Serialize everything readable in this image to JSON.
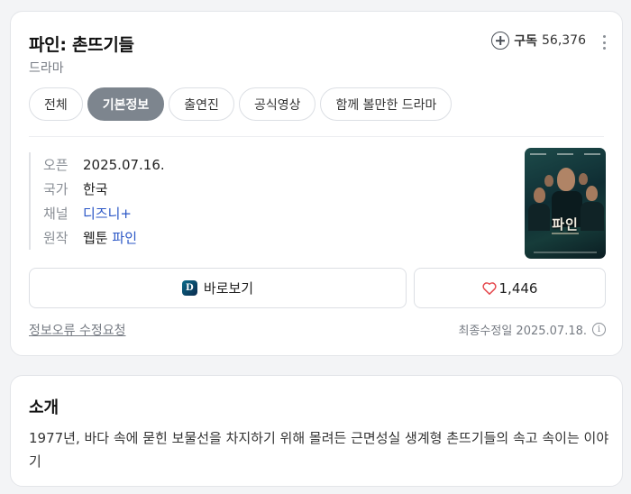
{
  "header": {
    "title": "파인: 촌뜨기들",
    "genre": "드라마",
    "subscribe_label": "구독",
    "subscriber_count": "56,376"
  },
  "tabs": [
    {
      "label": "전체",
      "active": false
    },
    {
      "label": "기본정보",
      "active": true
    },
    {
      "label": "출연진",
      "active": false
    },
    {
      "label": "공식영상",
      "active": false
    },
    {
      "label": "함께 볼만한 드라마",
      "active": false
    }
  ],
  "info": {
    "open_key": "오픈",
    "open_value": "2025.07.16.",
    "country_key": "국가",
    "country_value": "한국",
    "channel_key": "채널",
    "channel_value": "디즈니+",
    "original_key": "원작",
    "original_type": "웹툰",
    "original_title": "파인"
  },
  "poster": {
    "title": "파인",
    "icon": "poster-image"
  },
  "actions": {
    "watch_label": "바로보기",
    "watch_icon": "disney-plus-icon",
    "like_count": "1,446",
    "like_icon": "heart-icon"
  },
  "footer": {
    "report_label": "정보오류 수정요청",
    "updated_label": "최종수정일 2025.07.18."
  },
  "intro": {
    "title": "소개",
    "text": "1977년, 바다 속에 묻힌 보물선을 차지하기 위해 몰려든 근면성실 생계형 촌뜨기들의 속고 속이는 이야기"
  },
  "colors": {
    "active_tab": "#7d858e",
    "link": "#2a56c6",
    "heart": "#e5484d"
  }
}
